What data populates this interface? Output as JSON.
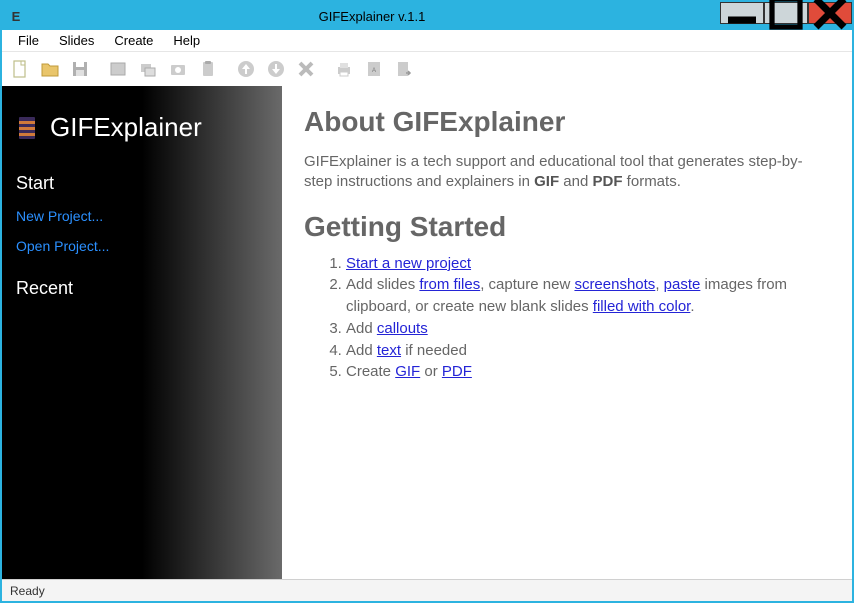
{
  "window": {
    "title": "GIFExplainer v.1.1"
  },
  "menu": {
    "file": "File",
    "slides": "Slides",
    "create": "Create",
    "help": "Help"
  },
  "sidebar": {
    "brand": "GIFExplainer",
    "start_head": "Start",
    "new_project": "New Project...",
    "open_project": "Open Project...",
    "recent_head": "Recent"
  },
  "content": {
    "about_title": "About GIFExplainer",
    "about_p_1": "GIFExplainer is a tech support and educational tool that generates step-by-step instructions and explainers in ",
    "about_gif": "GIF",
    "about_p_2": " and ",
    "about_pdf": "PDF",
    "about_p_3": " formats.",
    "getting_started": "Getting Started",
    "li1": "Start a new project",
    "li2_a": "Add slides ",
    "li2_link1": "from files",
    "li2_b": ", capture new ",
    "li2_link2": "screenshots",
    "li2_c": ", ",
    "li2_link3": "paste",
    "li2_d": " images from clipboard, or create new blank slides ",
    "li2_link4": "filled with color",
    "li2_e": ".",
    "li3_a": "Add ",
    "li3_link": "callouts",
    "li4_a": "Add ",
    "li4_link": "text",
    "li4_b": " if needed",
    "li5_a": "Create ",
    "li5_link1": "GIF",
    "li5_b": " or ",
    "li5_link2": "PDF"
  },
  "status": {
    "text": "Ready"
  }
}
